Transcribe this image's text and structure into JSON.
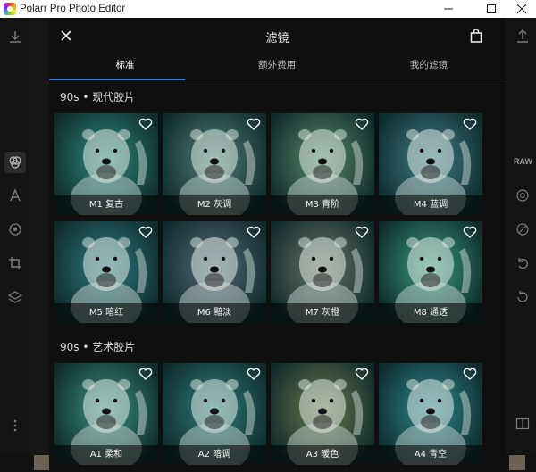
{
  "window": {
    "title": "Polarr Pro Photo Editor"
  },
  "dialog": {
    "title": "滤镜",
    "tabs": [
      {
        "label": "标准",
        "active": true
      },
      {
        "label": "额外费用",
        "active": false
      },
      {
        "label": "我的滤镜",
        "active": false
      }
    ],
    "sections": [
      {
        "title": "90s • 现代胶片",
        "filters": [
          {
            "label": "M1 复古",
            "tint": "#2f8a7c"
          },
          {
            "label": "M2 灰调",
            "tint": "#4f7f78"
          },
          {
            "label": "M3 青阶",
            "tint": "#5a8a6c"
          },
          {
            "label": "M4 蓝调",
            "tint": "#3f7f88"
          },
          {
            "label": "M5 暗红",
            "tint": "#2f7c80"
          },
          {
            "label": "M6 黯淡",
            "tint": "#566a78"
          },
          {
            "label": "M7 灰橙",
            "tint": "#6a7468"
          },
          {
            "label": "M8 通透",
            "tint": "#3a9c80"
          }
        ]
      },
      {
        "title": "90s • 艺术胶片",
        "filters": [
          {
            "label": "A1 柔和",
            "tint": "#3c9282"
          },
          {
            "label": "A2 暗调",
            "tint": "#2f7f7c"
          },
          {
            "label": "A3 暖色",
            "tint": "#6c7a52"
          },
          {
            "label": "A4 青空",
            "tint": "#2f8a90"
          }
        ]
      }
    ]
  },
  "background": {
    "right_rail_label": "RAW"
  },
  "colors": {
    "accent": "#2d7cf6",
    "dialog_bg": "#0f0f0f"
  }
}
